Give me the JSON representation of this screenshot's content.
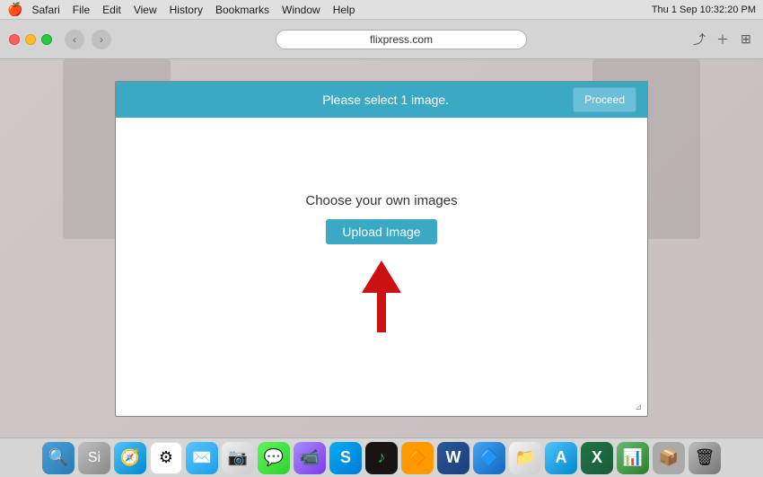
{
  "menubar": {
    "apple": "🍎",
    "items": [
      "Safari",
      "File",
      "Edit",
      "View",
      "History",
      "Bookmarks",
      "Window",
      "Help"
    ],
    "right": "Thu 1 Sep  10:32:20 PM"
  },
  "browser": {
    "address": "flixpress.com",
    "nav_back": "‹",
    "nav_forward": "›"
  },
  "modal": {
    "header_text": "Please select 1 image.",
    "proceed_label": "Proceed",
    "choose_text": "Choose your own images",
    "upload_label": "Upload Image"
  },
  "resize_handle": "⇲",
  "dock": {
    "items": [
      {
        "name": "finder",
        "icon": "🔍",
        "class": "dock-finder"
      },
      {
        "name": "siri",
        "icon": "🎤",
        "class": "dock-siri"
      },
      {
        "name": "safari",
        "icon": "🧭",
        "class": "dock-safari"
      },
      {
        "name": "chrome",
        "icon": "⚙",
        "class": "dock-chrome"
      },
      {
        "name": "mail",
        "icon": "✉️",
        "class": "dock-mail"
      },
      {
        "name": "photos",
        "icon": "📷",
        "class": "dock-photos"
      },
      {
        "name": "messages",
        "icon": "💬",
        "class": "dock-messages"
      },
      {
        "name": "facetime",
        "icon": "📹",
        "class": "dock-facetime2"
      },
      {
        "name": "skype",
        "icon": "S",
        "class": "dock-skype"
      },
      {
        "name": "spotify",
        "icon": "♪",
        "class": "dock-spotify"
      },
      {
        "name": "vlc",
        "icon": "🔶",
        "class": "dock-vlc"
      },
      {
        "name": "word",
        "icon": "W",
        "class": "dock-word"
      },
      {
        "name": "blue-app",
        "icon": "🔷",
        "class": "dock-blue"
      },
      {
        "name": "files",
        "icon": "📁",
        "class": "dock-files"
      },
      {
        "name": "appstore",
        "icon": "A",
        "class": "dock-appstore"
      },
      {
        "name": "excel",
        "icon": "X",
        "class": "dock-excel"
      },
      {
        "name": "green-app",
        "icon": "📊",
        "class": "dock-green"
      },
      {
        "name": "grey-app",
        "icon": "📦",
        "class": "dock-grey"
      },
      {
        "name": "trash",
        "icon": "🗑",
        "class": "dock-trash"
      }
    ]
  }
}
